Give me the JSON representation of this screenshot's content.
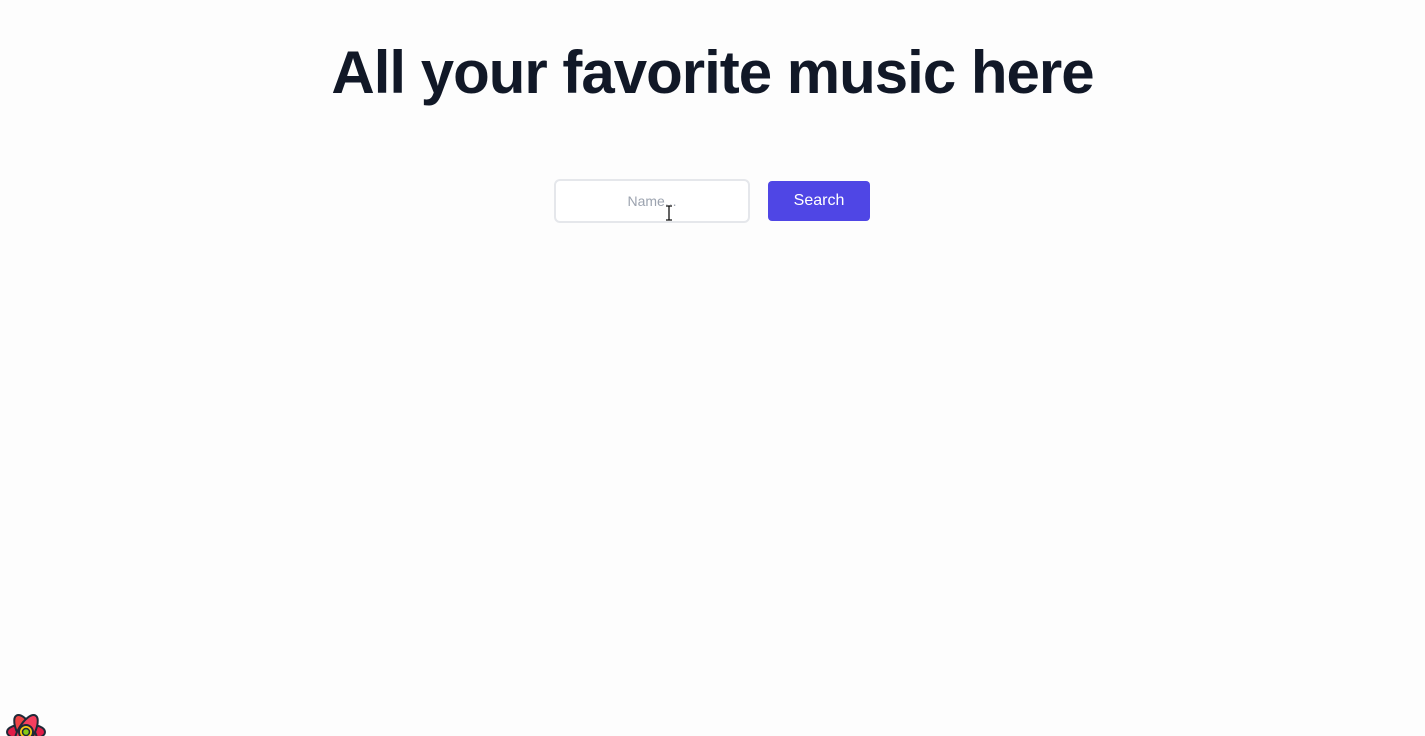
{
  "header": {
    "title": "All your favorite music here"
  },
  "search": {
    "placeholder": "Name...",
    "value": "",
    "button_label": "Search"
  },
  "overlay": {
    "cursor": "text-cursor-icon",
    "devtools_icon": "react-query-flower-icon"
  },
  "colors": {
    "accent": "#4f46e5",
    "heading": "#111827",
    "background": "#fdfdfd",
    "input_border": "#e5e7eb"
  }
}
